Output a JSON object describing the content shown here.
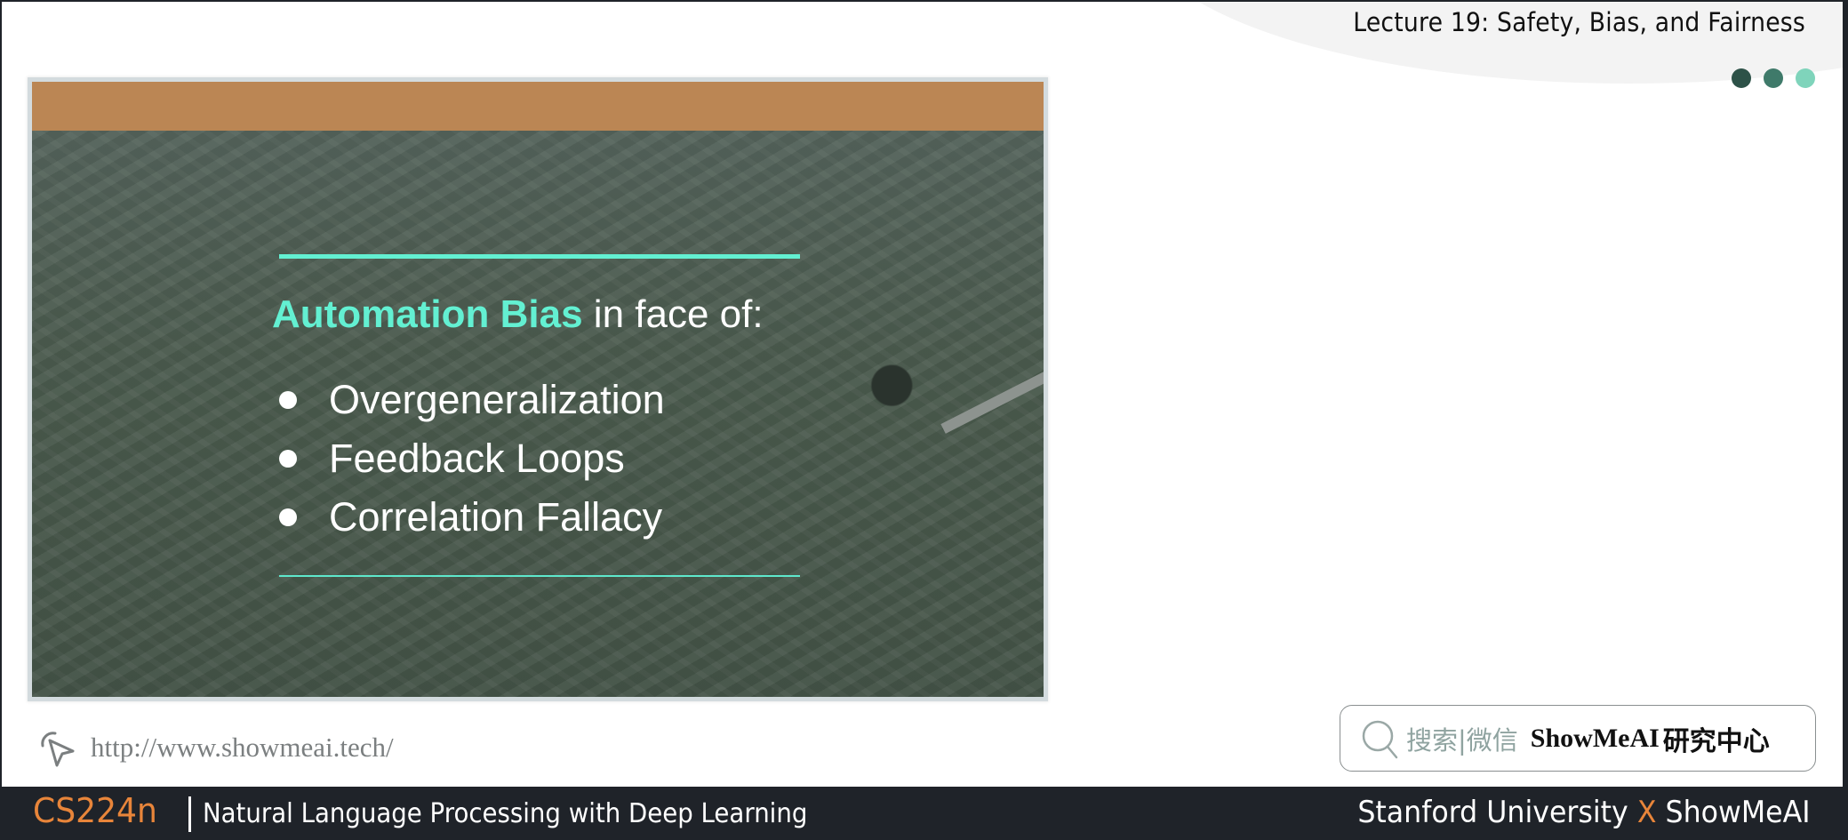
{
  "header": {
    "lecture_title": "Lecture 19: Safety, Bias, and Fairness",
    "dots": [
      "#2d5248",
      "#3f7a6a",
      "#7fd4bb"
    ]
  },
  "slide": {
    "topbar_color": "#bb8654",
    "accent_color": "#63f0d2",
    "heading_accent": "Automation Bias",
    "heading_rest": " in face of:",
    "bullets": [
      "Overgeneralization",
      "Feedback Loops",
      "Correlation Fallacy"
    ]
  },
  "link": {
    "icon": "cursor-click-icon",
    "url": "http://www.showmeai.tech/"
  },
  "search": {
    "icon": "search-icon",
    "hint": "搜索|微信",
    "brand": "ShowMeAI",
    "brand_cn": "研究中心"
  },
  "footer": {
    "course_code": "CS224n",
    "course_name": "Natural Language Processing with Deep Learning",
    "credit_left": "Stanford University",
    "credit_x": "X",
    "credit_right": "ShowMeAI"
  }
}
